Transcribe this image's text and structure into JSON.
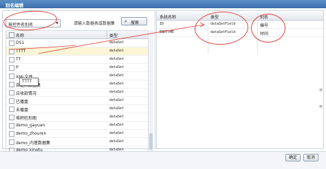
{
  "window": {
    "title": "别名编辑"
  },
  "left": {
    "filter_select": "按控件名别名",
    "search_hint": "请输入数据表或数据集",
    "search_button": "搜索",
    "columns": {
      "name": "名称",
      "type": "类型"
    },
    "rows": [
      {
        "name": "DS1",
        "type": "dataSet"
      },
      {
        "name": "TTTT",
        "type": "dataSet"
      },
      {
        "name": "TT",
        "type": "dataSet"
      },
      {
        "name": "P",
        "type": "dataSet"
      },
      {
        "name": "XML文件",
        "type": "dataSet"
      },
      {
        "name": "自定义数据集",
        "type": "dataSet"
      },
      {
        "name": "应收款情况",
        "type": "dataSet"
      },
      {
        "name": "已播盘",
        "type": "dataSet"
      },
      {
        "name": "未播盘",
        "type": "dataSet"
      },
      {
        "name": "堆积柱形图",
        "type": "dataSet"
      },
      {
        "name": "demo_gayuan",
        "type": "dataSet"
      },
      {
        "name": "demo_zhouren",
        "type": "dataSet"
      },
      {
        "name": "demo_内蓬数据集",
        "type": "dataSet"
      },
      {
        "name": "demo_kingtu",
        "type": "dataSet"
      }
    ],
    "tooltip": "TTTT"
  },
  "right": {
    "columns": {
      "sys_name": "系统名称",
      "type": "类型",
      "alias": "别名"
    },
    "rows": [
      {
        "sys_name": "ID",
        "type": "dataSetField",
        "alias": "编号"
      },
      {
        "sys_name": "ENDTYME",
        "type": "dataSetField",
        "alias": "时间"
      }
    ]
  },
  "footer": {
    "ok_button": "确定",
    "cancel_button": "取消"
  },
  "edge_text": [
    "可",
    "可"
  ],
  "colors": {
    "title_bar": "#3c6eaa",
    "selected_row": "#fbf6d5",
    "annotation": "#e0403a"
  }
}
